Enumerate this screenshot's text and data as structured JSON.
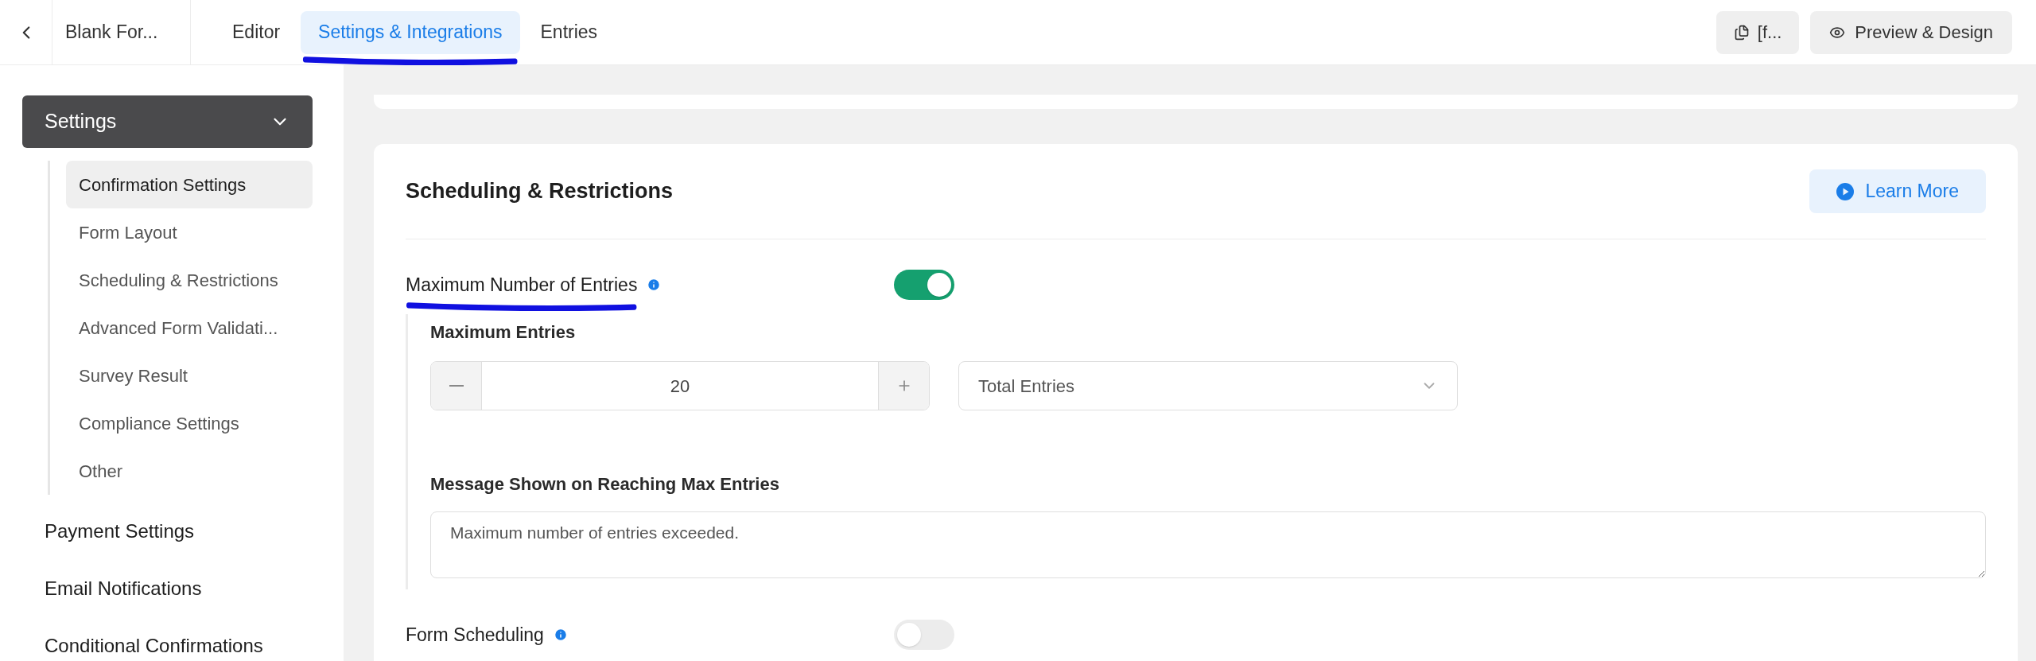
{
  "header": {
    "form_title": "Blank For...",
    "tabs": [
      {
        "label": "Editor",
        "selected": false
      },
      {
        "label": "Settings & Integrations",
        "selected": true
      },
      {
        "label": "Entries",
        "selected": false
      }
    ],
    "shortcode_button": "[f...",
    "preview_button": "Preview & Design"
  },
  "sidebar": {
    "group": {
      "label": "Settings",
      "expanded": true,
      "children": [
        {
          "label": "Confirmation Settings",
          "selected": true
        },
        {
          "label": "Form Layout",
          "selected": false
        },
        {
          "label": "Scheduling & Restrictions",
          "selected": false
        },
        {
          "label": "Advanced Form Validati...",
          "selected": false
        },
        {
          "label": "Survey Result",
          "selected": false
        },
        {
          "label": "Compliance Settings",
          "selected": false
        },
        {
          "label": "Other",
          "selected": false
        }
      ]
    },
    "items": [
      "Payment Settings",
      "Email Notifications",
      "Conditional Confirmations"
    ]
  },
  "card": {
    "title": "Scheduling & Restrictions",
    "learn_more": "Learn More",
    "settings": [
      {
        "label": "Maximum Number of Entries",
        "on": true,
        "details": {
          "count_label": "Maximum Entries",
          "count": "20",
          "period": "Total Entries",
          "message_label": "Message Shown on Reaching Max Entries",
          "message": "Maximum number of entries exceeded."
        }
      },
      {
        "label": "Form Scheduling",
        "on": false
      }
    ]
  }
}
